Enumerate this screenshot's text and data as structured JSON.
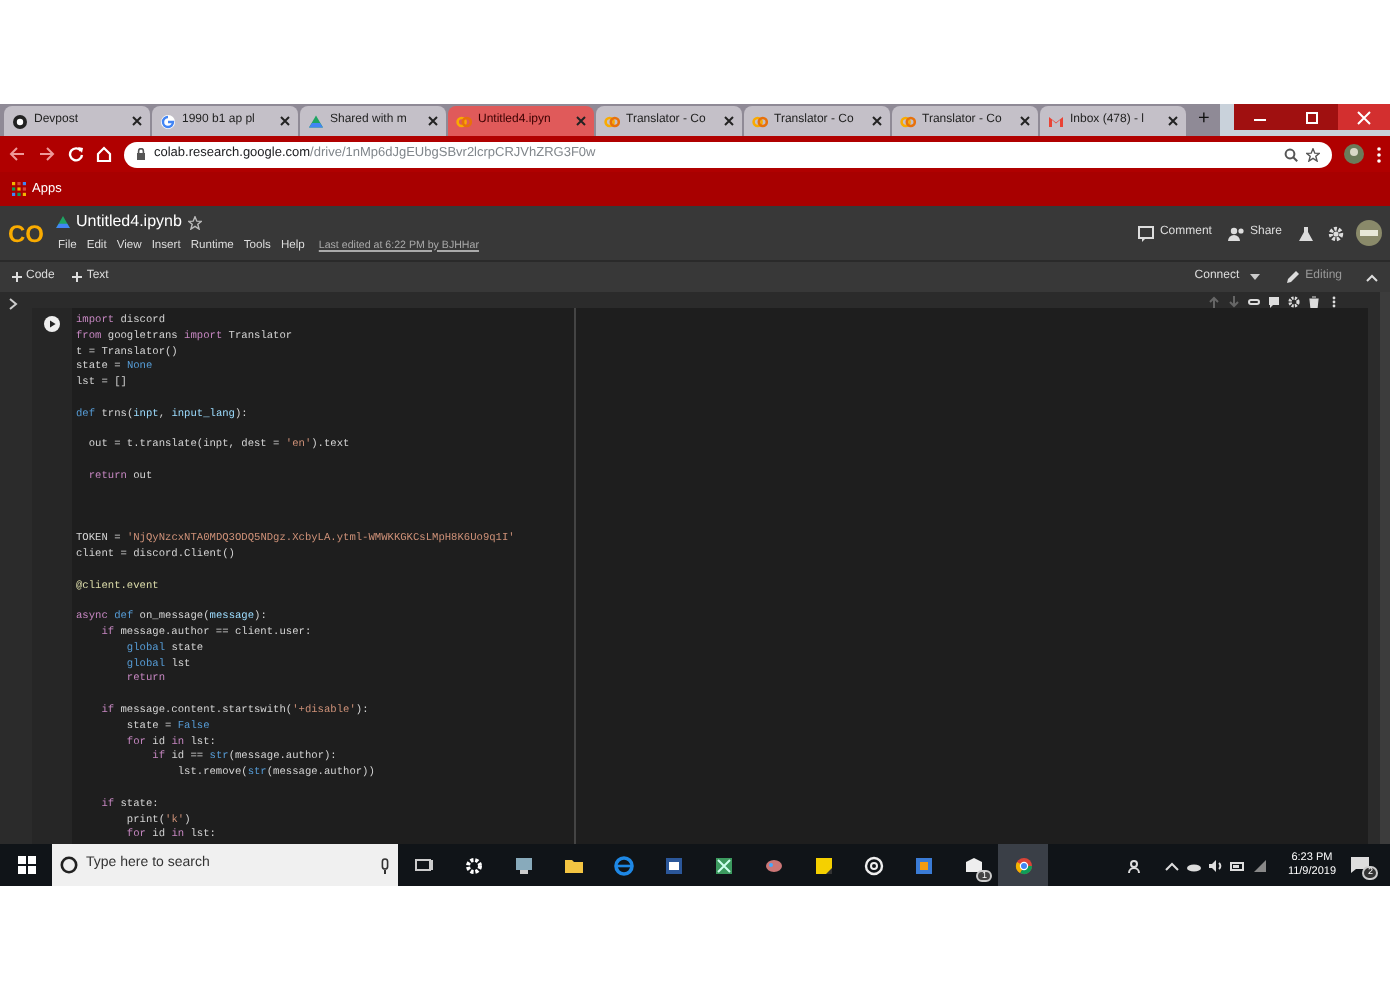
{
  "browser": {
    "tabs": [
      {
        "label": "Devpost",
        "kind": "dark",
        "selected": false
      },
      {
        "label": "1990 b1 ap pl",
        "kind": "google",
        "selected": false
      },
      {
        "label": "Shared with m",
        "kind": "drive",
        "selected": false
      },
      {
        "label": "Untitled4.ipyn",
        "kind": "colab",
        "selected": true
      },
      {
        "label": "Translator - Co",
        "kind": "colab",
        "selected": false
      },
      {
        "label": "Translator - Co",
        "kind": "colab",
        "selected": false
      },
      {
        "label": "Translator - Co",
        "kind": "colab",
        "selected": false
      },
      {
        "label": "Inbox (478) - l",
        "kind": "mail",
        "selected": false
      }
    ],
    "new_tab": "+",
    "address": {
      "domain": "colab.research.google.com",
      "path": "/drive/1nMp6dJgEUbgSBvr2lcrpCRJVhZRG3F0w"
    },
    "bookmarks": [
      "Apps"
    ]
  },
  "colab": {
    "logo": "CO",
    "title": "Untitled4.ipynb",
    "menu": [
      "File",
      "Edit",
      "View",
      "Insert",
      "Runtime",
      "Tools",
      "Help"
    ],
    "last_edited": "Last edited at 6:22 PM by BJHHar",
    "actions": [
      "Comment",
      "Share"
    ],
    "toolbar": {
      "add": [
        "Code",
        "Text"
      ],
      "connect": "Connect",
      "editing": "Editing"
    },
    "code": [
      {
        "kind": "code",
        "segments": [
          {
            "text": "import",
            "kind": "kw"
          },
          {
            "text": " discord",
            "kind": "plain"
          }
        ]
      },
      {
        "kind": "code",
        "segments": [
          {
            "text": "from",
            "kind": "kw"
          },
          {
            "text": " googletrans ",
            "kind": "plain"
          },
          {
            "text": "import",
            "kind": "kw"
          },
          {
            "text": " Translator",
            "kind": "plain"
          }
        ]
      },
      {
        "kind": "code",
        "segments": [
          {
            "text": "t = Translator()",
            "kind": "plain"
          }
        ]
      },
      {
        "kind": "code",
        "segments": [
          {
            "text": "state = ",
            "kind": "plain"
          },
          {
            "text": "None",
            "kind": "const"
          }
        ]
      },
      {
        "kind": "code",
        "segments": [
          {
            "text": "lst = []",
            "kind": "plain"
          }
        ]
      },
      {
        "kind": "blank"
      },
      {
        "kind": "code",
        "segments": [
          {
            "text": "def",
            "kind": "def"
          },
          {
            "text": " trns(",
            "kind": "plain"
          },
          {
            "text": "inpt",
            "kind": "param"
          },
          {
            "text": ", ",
            "kind": "plain"
          },
          {
            "text": "input_lang",
            "kind": "param"
          },
          {
            "text": "):",
            "kind": "plain"
          }
        ]
      },
      {
        "kind": "blank"
      },
      {
        "kind": "code",
        "segments": [
          {
            "text": "  out = t.translate(inpt, dest = ",
            "kind": "plain"
          },
          {
            "text": "'en'",
            "kind": "str"
          },
          {
            "text": ").text",
            "kind": "plain"
          }
        ]
      },
      {
        "kind": "blank"
      },
      {
        "kind": "code",
        "segments": [
          {
            "text": "  return",
            "kind": "kw"
          },
          {
            "text": " out",
            "kind": "plain"
          }
        ]
      },
      {
        "kind": "blank"
      },
      {
        "kind": "blank"
      },
      {
        "kind": "blank"
      },
      {
        "kind": "code",
        "segments": [
          {
            "text": "TOKEN = ",
            "kind": "plain"
          },
          {
            "text": "'NjQyNzcxNTA0MDQ3ODQ5NDgz.XcbyLA.ytml-WMWKKGKCsLMpH8K6Uo9q1I'",
            "kind": "str"
          }
        ]
      },
      {
        "kind": "code",
        "segments": [
          {
            "text": "client = discord.Client()",
            "kind": "plain"
          }
        ]
      },
      {
        "kind": "blank"
      },
      {
        "kind": "code",
        "segments": [
          {
            "text": "@client.event",
            "kind": "deco"
          }
        ]
      },
      {
        "kind": "blank"
      },
      {
        "kind": "code",
        "segments": [
          {
            "text": "async",
            "kind": "kw"
          },
          {
            "text": " def",
            "kind": "def"
          },
          {
            "text": " on_message(",
            "kind": "plain"
          },
          {
            "text": "message",
            "kind": "param"
          },
          {
            "text": "):",
            "kind": "plain"
          }
        ]
      },
      {
        "kind": "code",
        "segments": [
          {
            "text": "    if",
            "kind": "kw"
          },
          {
            "text": " message.author == client.user:",
            "kind": "plain"
          }
        ]
      },
      {
        "kind": "code",
        "segments": [
          {
            "text": "        global",
            "kind": "def"
          },
          {
            "text": " state",
            "kind": "plain"
          }
        ]
      },
      {
        "kind": "code",
        "segments": [
          {
            "text": "        global",
            "kind": "def"
          },
          {
            "text": " lst",
            "kind": "plain"
          }
        ]
      },
      {
        "kind": "code",
        "segments": [
          {
            "text": "        return",
            "kind": "kw"
          }
        ]
      },
      {
        "kind": "blank"
      },
      {
        "kind": "code",
        "segments": [
          {
            "text": "    if",
            "kind": "kw"
          },
          {
            "text": " message.content.startswith(",
            "kind": "plain"
          },
          {
            "text": "'+disable'",
            "kind": "str"
          },
          {
            "text": "):",
            "kind": "plain"
          }
        ]
      },
      {
        "kind": "code",
        "segments": [
          {
            "text": "        state = ",
            "kind": "plain"
          },
          {
            "text": "False",
            "kind": "const"
          }
        ]
      },
      {
        "kind": "code",
        "segments": [
          {
            "text": "        for",
            "kind": "kw"
          },
          {
            "text": " id ",
            "kind": "plain"
          },
          {
            "text": "in",
            "kind": "kw"
          },
          {
            "text": " lst:",
            "kind": "plain"
          }
        ]
      },
      {
        "kind": "code",
        "segments": [
          {
            "text": "            if",
            "kind": "kw"
          },
          {
            "text": " id == ",
            "kind": "plain"
          },
          {
            "text": "str",
            "kind": "def"
          },
          {
            "text": "(message.author):",
            "kind": "plain"
          }
        ]
      },
      {
        "kind": "code",
        "segments": [
          {
            "text": "                lst.remove(",
            "kind": "plain"
          },
          {
            "text": "str",
            "kind": "def"
          },
          {
            "text": "(message.author))",
            "kind": "plain"
          }
        ]
      },
      {
        "kind": "blank"
      },
      {
        "kind": "code",
        "segments": [
          {
            "text": "    if",
            "kind": "kw"
          },
          {
            "text": " state:",
            "kind": "plain"
          }
        ]
      },
      {
        "kind": "code",
        "segments": [
          {
            "text": "        print(",
            "kind": "plain"
          },
          {
            "text": "'k'",
            "kind": "str"
          },
          {
            "text": ")",
            "kind": "plain"
          }
        ]
      },
      {
        "kind": "code",
        "segments": [
          {
            "text": "        for",
            "kind": "kw"
          },
          {
            "text": " id ",
            "kind": "plain"
          },
          {
            "text": "in",
            "kind": "kw"
          },
          {
            "text": " lst:",
            "kind": "plain"
          }
        ]
      }
    ]
  },
  "taskbar": {
    "search_placeholder": "Type here to search",
    "mail_badge": "1",
    "time": "6:23 PM",
    "date": "11/9/2019",
    "notifications": "2"
  }
}
